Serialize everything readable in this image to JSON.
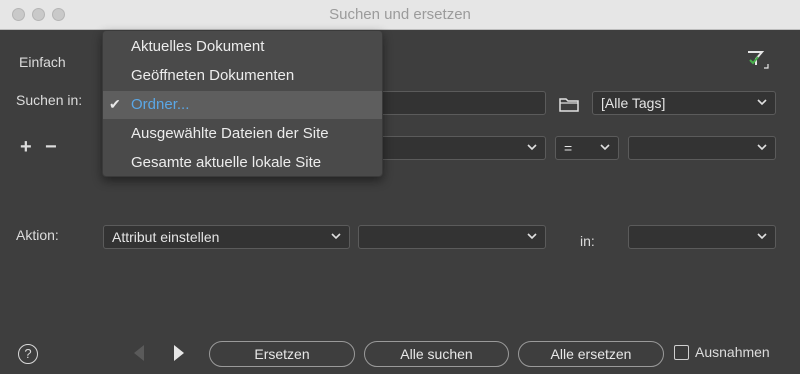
{
  "window": {
    "title": "Suchen und ersetzen"
  },
  "mode_label": "Einfach",
  "search_in": {
    "label": "Suchen in:",
    "selected": "Ordner...",
    "tags": "[Alle Tags]"
  },
  "menu": {
    "items": [
      {
        "label": "Aktuelles Dokument"
      },
      {
        "label": "Geöffneten Dokumenten"
      },
      {
        "label": "Ordner...",
        "selected": true
      },
      {
        "label": "Ausgewählte Dateien der Site"
      },
      {
        "label": "Gesamte aktuelle lokale Site"
      }
    ]
  },
  "condition": {
    "plus": "+",
    "minus": "−",
    "operator": "="
  },
  "action": {
    "label": "Aktion:",
    "value": "Attribut einstellen",
    "in_label": "in:"
  },
  "footer": {
    "help": "?",
    "replace": "Ersetzen",
    "find_all": "Alle suchen",
    "replace_all": "Alle ersetzen",
    "exceptions": "Ausnahmen"
  },
  "colors": {
    "accent": "#5aa7e6",
    "filter_check": "#47b04b"
  }
}
